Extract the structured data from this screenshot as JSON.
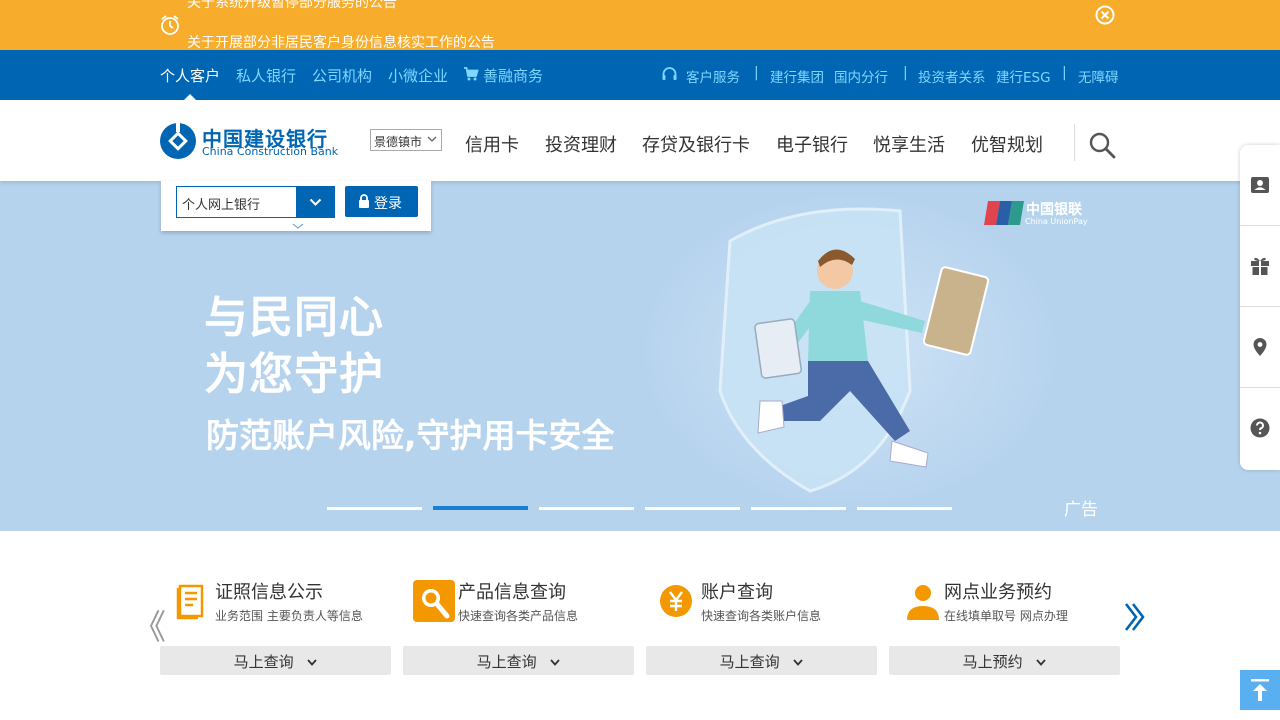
{
  "notice": {
    "line1": "关于系统升级暂停部分服务的公告",
    "line2": "关于开展部分非居民客户身份信息核实工作的公告",
    "alarm_icon": "alarm-clock-icon",
    "close_icon": "close-circle-icon"
  },
  "topnav": {
    "items": [
      "个人客户",
      "私人银行",
      "公司机构",
      "小微企业",
      "善融商务"
    ],
    "right": {
      "service": "客户服务",
      "group": "建行集团",
      "domestic": "国内分行",
      "investor": "投资者关系",
      "esg": "建行ESG",
      "accessible": "无障碍",
      "separator": "|"
    }
  },
  "header": {
    "logo_cn": "中国建设银行",
    "logo_en": "China Construction Bank",
    "city": "景德镇市",
    "nav": [
      "信用卡",
      "投资理财",
      "存贷及银行卡",
      "电子银行",
      "悦享生活",
      "优智规划"
    ]
  },
  "login": {
    "channel": "个人网上银行",
    "button": "登录"
  },
  "banner": {
    "headline1": "与民同心",
    "headline2": "为您守护",
    "subline": "防范账户风险,守护用卡安全",
    "ad": "广告",
    "unionpay_cn": "中国银联",
    "unionpay_en": "China UnionPay",
    "slides": 6,
    "active_slide": 2
  },
  "services": [
    {
      "title": "证照信息公示",
      "desc": "业务范围 主要负责人等信息",
      "action": "马上查询",
      "icon": "document-icon",
      "color": "#f39800"
    },
    {
      "title": "产品信息查询",
      "desc": "快速查询各类产品信息",
      "action": "马上查询",
      "icon": "magnifier-icon",
      "color": "#f39800"
    },
    {
      "title": "账户查询",
      "desc": "快速查询各类账户信息",
      "action": "马上查询",
      "icon": "yuan-coin-icon",
      "color": "#f39800"
    },
    {
      "title": "网点业务预约",
      "desc": "在线填单取号 网点办理",
      "action": "马上预约",
      "icon": "person-icon",
      "color": "#f39800"
    }
  ],
  "carousel": {
    "prev": "《",
    "next": "》"
  },
  "colors": {
    "brand_blue": "#0066b3",
    "notice_orange": "#f7ac2c",
    "link_cyan": "#7fd6ff",
    "banner_bg": "#b6d3ee"
  }
}
